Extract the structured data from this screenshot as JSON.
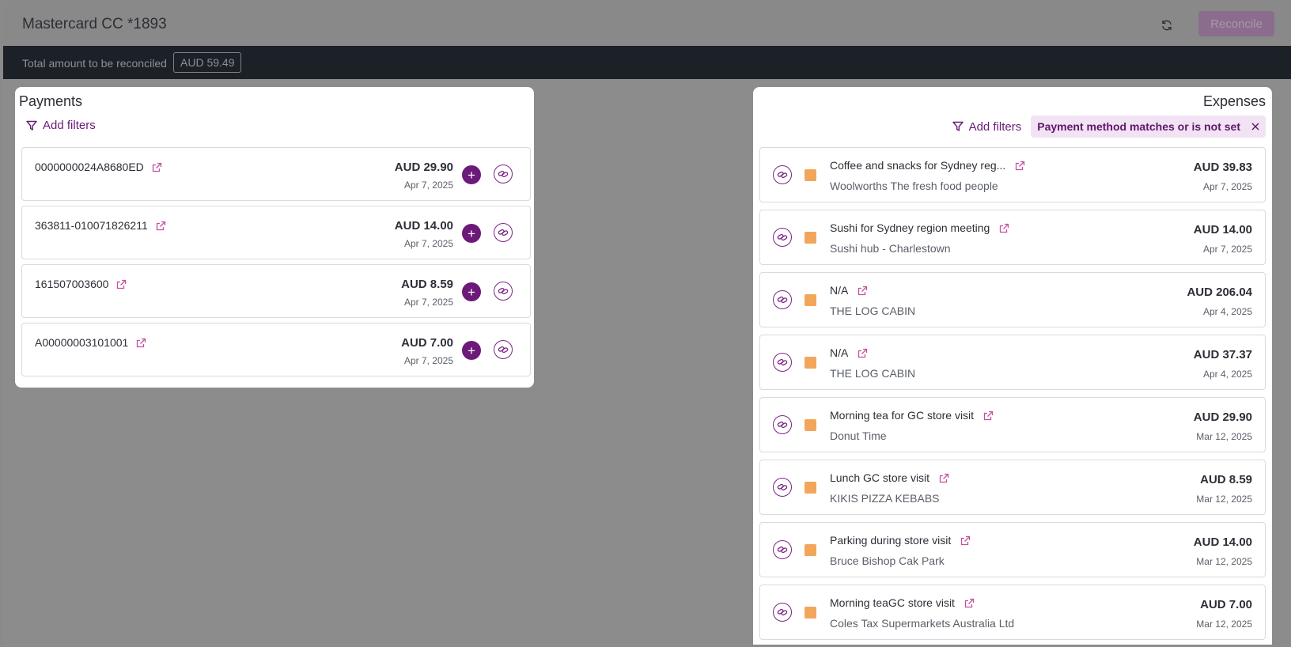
{
  "header": {
    "title": "Mastercard CC *1893",
    "reconcile_label": "Reconcile"
  },
  "total": {
    "label": "Total amount to be reconciled",
    "amount": "AUD 59.49"
  },
  "payments": {
    "title": "Payments",
    "add_filters": "Add filters",
    "items": [
      {
        "ref": "0000000024A8680ED",
        "amount": "AUD 29.90",
        "date": "Apr 7, 2025"
      },
      {
        "ref": "363811-010071826211",
        "amount": "AUD 14.00",
        "date": "Apr 7, 2025"
      },
      {
        "ref": "161507003600",
        "amount": "AUD 8.59",
        "date": "Apr 7, 2025"
      },
      {
        "ref": "A00000003101001",
        "amount": "AUD 7.00",
        "date": "Apr 7, 2025"
      }
    ]
  },
  "expenses": {
    "title": "Expenses",
    "add_filters": "Add filters",
    "filter_chip": "Payment method matches or is not set",
    "items": [
      {
        "title": "Coffee and snacks for Sydney reg...",
        "merchant": "Woolworths The fresh food people",
        "amount": "AUD 39.83",
        "date": "Apr 7, 2025"
      },
      {
        "title": "Sushi for Sydney region meeting",
        "merchant": "Sushi hub - Charlestown",
        "amount": "AUD 14.00",
        "date": "Apr 7, 2025"
      },
      {
        "title": "N/A",
        "merchant": "THE LOG CABIN",
        "amount": "AUD 206.04",
        "date": "Apr 4, 2025"
      },
      {
        "title": "N/A",
        "merchant": "THE LOG CABIN",
        "amount": "AUD 37.37",
        "date": "Apr 4, 2025"
      },
      {
        "title": "Morning tea for GC store visit",
        "merchant": "Donut Time",
        "amount": "AUD 29.90",
        "date": "Mar 12, 2025"
      },
      {
        "title": "Lunch GC store visit",
        "merchant": "KIKIS PIZZA KEBABS",
        "amount": "AUD 8.59",
        "date": "Mar 12, 2025"
      },
      {
        "title": "Parking during store visit",
        "merchant": "Bruce Bishop Cak Park",
        "amount": "AUD 14.00",
        "date": "Mar 12, 2025"
      },
      {
        "title": "Morning teaGC store visit",
        "merchant": "Coles Tax Supermarkets Australia Ltd",
        "amount": "AUD 7.00",
        "date": "Mar 12, 2025"
      }
    ]
  },
  "colors": {
    "accent": "#6c1a7a",
    "chip_bg": "#f1e3f3",
    "category_square": "#f2a65c",
    "total_bar": "#1c2128"
  },
  "icons": [
    "refresh-icon",
    "filter-icon",
    "close-icon",
    "external-link-icon",
    "plus-icon",
    "link-icon"
  ]
}
